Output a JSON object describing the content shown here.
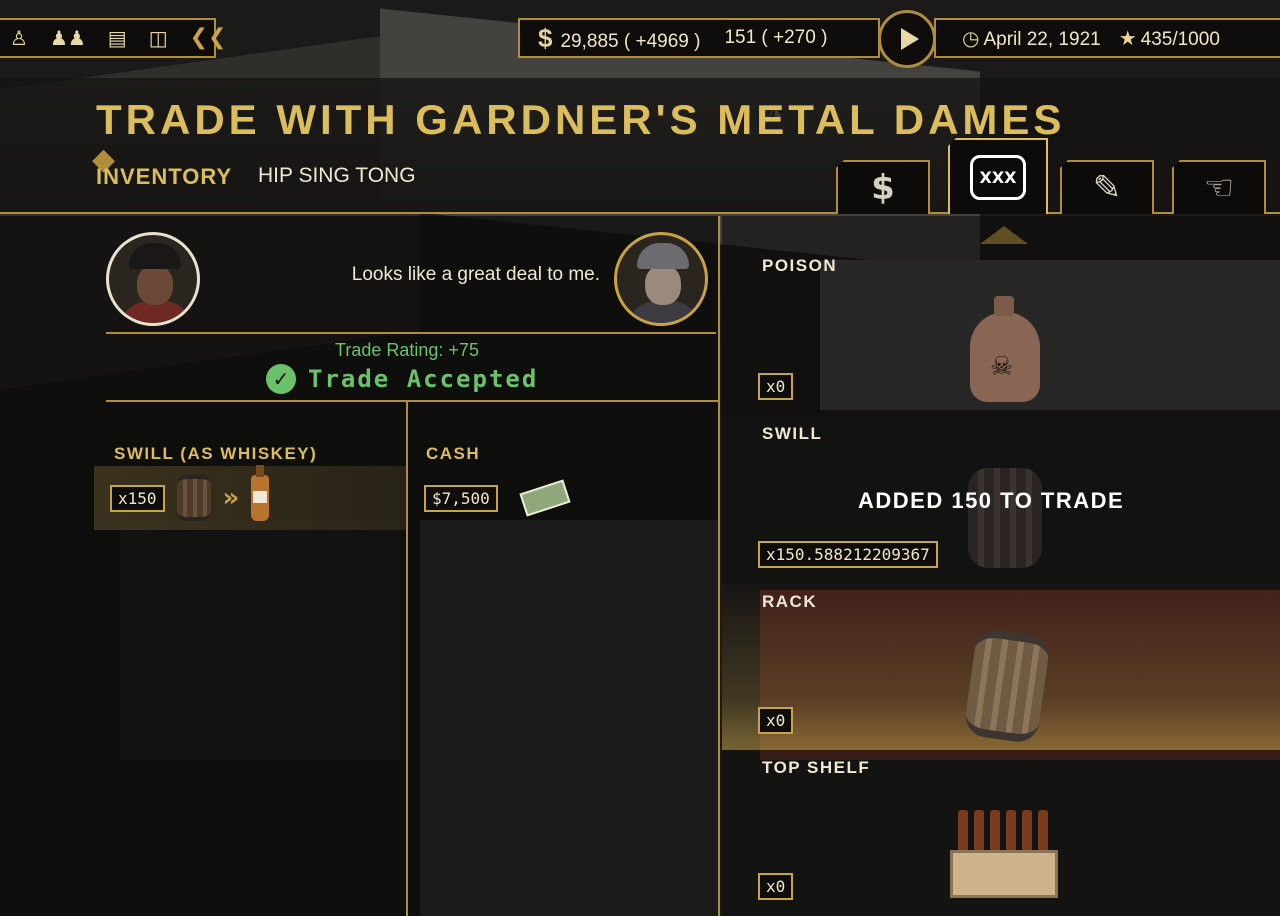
{
  "topbar": {
    "icons": [
      "agent-icon",
      "family-icon",
      "ledger-icon",
      "briefcase-icon",
      "collapse-arrow-icon"
    ],
    "cash": "29,885 ( +4969 )",
    "booze": "151 ( +270 )",
    "date": "April 22, 1921",
    "heat": "435/1000"
  },
  "header": {
    "title": "TRADE WITH GARDNER'S METAL DAMES",
    "inventory_label": "INVENTORY",
    "inventory_owner": "HIP SING TONG",
    "tabs": [
      {
        "label": "$",
        "icon": "cash-tab-icon",
        "active": false
      },
      {
        "label": "XXX",
        "icon": "booze-jug-tab-icon",
        "active": true
      },
      {
        "label": "tommy-gun",
        "icon": "tommy-gun-icon",
        "active": false
      },
      {
        "label": "pistol",
        "icon": "pistol-icon",
        "active": false
      }
    ]
  },
  "deal": {
    "quote": "Looks like a great deal to me.",
    "rating": "Trade Rating: +75",
    "status": "Trade Accepted"
  },
  "offer": {
    "left_label": "SWILL (AS WHISKEY)",
    "left_qty": "x150",
    "right_label": "CASH",
    "right_amount": "$7,500"
  },
  "inventory_items": [
    {
      "name": "POISON",
      "count": "x0"
    },
    {
      "name": "SWILL",
      "count": "x150.588212209367"
    },
    {
      "name": "RACK",
      "count": "x0"
    },
    {
      "name": "TOP SHELF",
      "count": "x0"
    }
  ],
  "toast": "ADDED 150 TO TRADE",
  "colors": {
    "gold": "#dcbd5c",
    "green": "#6cc26b",
    "panel": "#0e0d0c"
  }
}
